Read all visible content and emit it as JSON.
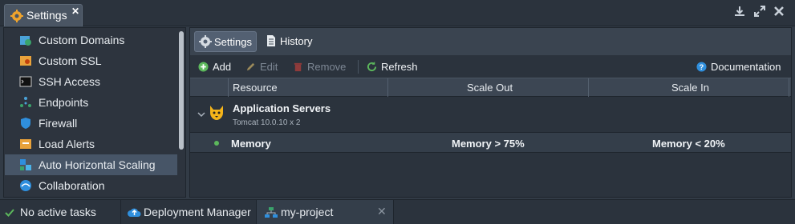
{
  "window": {
    "tab_title": "Settings",
    "controls": [
      "download-icon",
      "expand-icon",
      "close-icon"
    ]
  },
  "sidebar": {
    "items": [
      {
        "label": "Custom Domains",
        "icon": "globe-icon",
        "active": false
      },
      {
        "label": "Custom SSL",
        "icon": "certificate-icon",
        "active": false
      },
      {
        "label": "SSH Access",
        "icon": "terminal-icon",
        "active": false
      },
      {
        "label": "Endpoints",
        "icon": "endpoints-icon",
        "active": false
      },
      {
        "label": "Firewall",
        "icon": "shield-icon",
        "active": false
      },
      {
        "label": "Load Alerts",
        "icon": "alert-icon",
        "active": false
      },
      {
        "label": "Auto Horizontal Scaling",
        "icon": "scaling-icon",
        "active": true
      },
      {
        "label": "Collaboration",
        "icon": "collaboration-icon",
        "active": false
      }
    ]
  },
  "subtabs": [
    {
      "label": "Settings",
      "icon": "gear-icon",
      "active": true
    },
    {
      "label": "History",
      "icon": "document-icon",
      "active": false
    }
  ],
  "toolbar": {
    "add": "Add",
    "edit": "Edit",
    "remove": "Remove",
    "refresh": "Refresh",
    "documentation": "Documentation"
  },
  "grid": {
    "columns": [
      "Resource",
      "Scale Out",
      "Scale In"
    ],
    "group": {
      "title": "Application Servers",
      "subtitle": "Tomcat 10.0.10 x 2",
      "icon": "tomcat-icon"
    },
    "rows": [
      {
        "resource": "Memory",
        "scale_out": "Memory > 75%",
        "scale_in": "Memory < 20%"
      }
    ]
  },
  "statusbar": {
    "tasks": "No active tasks",
    "deployment_manager": "Deployment Manager",
    "project": "my-project"
  },
  "colors": {
    "background": "#323b46",
    "active_item": "#475567",
    "add_green": "#5cb85c",
    "remove_red": "#c9302c",
    "help_blue": "#2f8fdd"
  }
}
